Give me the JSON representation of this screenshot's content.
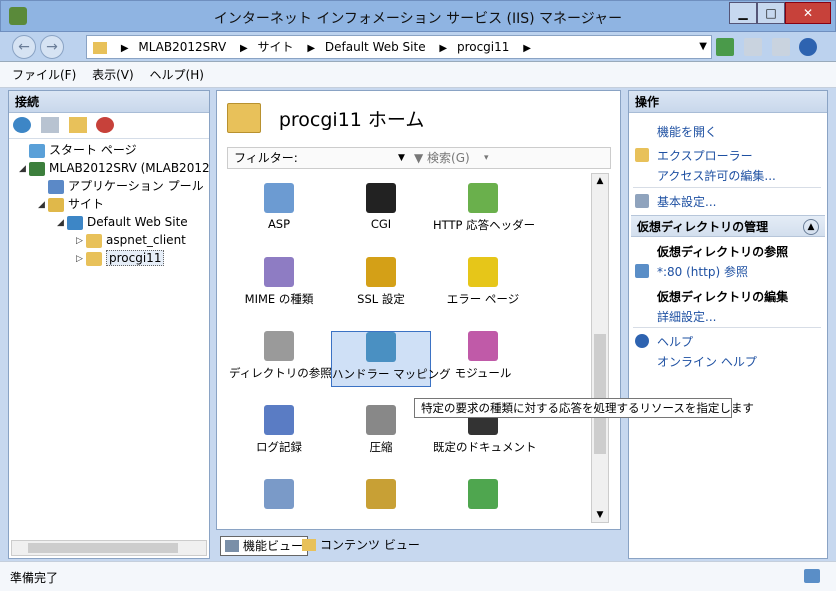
{
  "window": {
    "title": "インターネット インフォメーション サービス (IIS) マネージャー"
  },
  "address": {
    "crumbs": [
      "MLAB2012SRV",
      "サイト",
      "Default Web Site",
      "procgi11"
    ]
  },
  "menu": [
    "ファイル(F)",
    "表示(V)",
    "ヘルプ(H)"
  ],
  "connections": {
    "header": "接続",
    "tree": [
      {
        "label": "スタート ページ",
        "depth": 0,
        "icon": "start-page-icon",
        "color": "#5aa0d8",
        "exp": ""
      },
      {
        "label": "MLAB2012SRV (MLAB2012",
        "depth": 0,
        "icon": "server-icon",
        "color": "#3c7f3c",
        "exp": "◢"
      },
      {
        "label": "アプリケーション プール",
        "depth": 1,
        "icon": "app-pool-icon",
        "color": "#5b89c7",
        "exp": ""
      },
      {
        "label": "サイト",
        "depth": 1,
        "icon": "sites-icon",
        "color": "#e0b84a",
        "exp": "◢"
      },
      {
        "label": "Default Web Site",
        "depth": 2,
        "icon": "globe-icon",
        "color": "#3d86c6",
        "exp": "◢"
      },
      {
        "label": "aspnet_client",
        "depth": 3,
        "icon": "folder-icon",
        "color": "#e8c15a",
        "exp": "▷"
      },
      {
        "label": "procgi11",
        "depth": 3,
        "icon": "app-folder-icon",
        "color": "#e8c15a",
        "exp": "▷"
      }
    ]
  },
  "center": {
    "title": "procgi11 ホーム",
    "filter_label": "フィルター:",
    "search_label": "検索(G)",
    "features": [
      {
        "label": "ASP",
        "icon": "asp-icon",
        "color": "#6c9bd2"
      },
      {
        "label": "CGI",
        "icon": "cgi-icon",
        "color": "#222222"
      },
      {
        "label": "HTTP 応答ヘッダー",
        "icon": "http-headers-icon",
        "color": "#6ab04c"
      },
      {
        "label": "MIME の種類",
        "icon": "mime-icon",
        "color": "#8e7cc3"
      },
      {
        "label": "SSL 設定",
        "icon": "lock-icon",
        "color": "#d4a017"
      },
      {
        "label": "エラー ページ",
        "icon": "error-page-icon",
        "color": "#e6c619"
      },
      {
        "label": "ディレクトリの参照",
        "icon": "dir-browse-icon",
        "color": "#9a9a9a"
      },
      {
        "label": "ハンドラー マッピング",
        "icon": "handler-mapping-icon",
        "color": "#4a90c2"
      },
      {
        "label": "モジュール",
        "icon": "modules-icon",
        "color": "#c05aa8"
      },
      {
        "label": "ログ記録",
        "icon": "logging-icon",
        "color": "#5a7cc4"
      },
      {
        "label": "圧縮",
        "icon": "compression-icon",
        "color": "#888888"
      },
      {
        "label": "既定のドキュメント",
        "icon": "default-doc-icon",
        "color": "#333333"
      },
      {
        "label": "",
        "icon": "server-config-icon",
        "color": "#7a9ac8"
      },
      {
        "label": "",
        "icon": "user-lock-icon",
        "color": "#c8a035"
      },
      {
        "label": "",
        "icon": "checklist-icon",
        "color": "#4fa64f"
      }
    ],
    "tooltip": "特定の要求の種類に対する応答を処理するリソースを指定します",
    "tabs": [
      "機能ビュー",
      "コンテンツ ビュー"
    ]
  },
  "actions": {
    "header": "操作",
    "open_feature": "機能を開く",
    "explorer": "エクスプローラー",
    "edit_perms": "アクセス許可の編集...",
    "basic_settings": "基本設定...",
    "vdir_section": "仮想ディレクトリの管理",
    "browse_head": "仮想ディレクトリの参照",
    "browse_link": "*:80 (http) 参照",
    "edit_head": "仮想ディレクトリの編集",
    "advanced": "詳細設定...",
    "help": "ヘルプ",
    "online_help": "オンライン ヘルプ"
  },
  "status": {
    "text": "準備完了"
  }
}
